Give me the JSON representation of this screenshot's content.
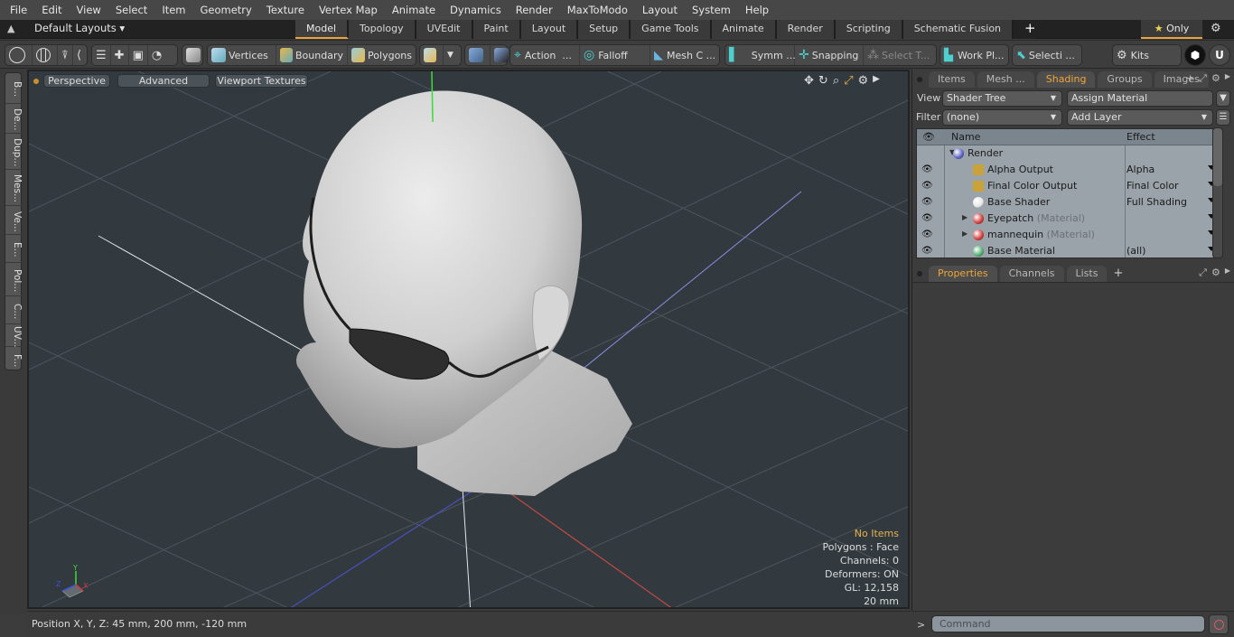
{
  "menubar": {
    "items": [
      "File",
      "Edit",
      "View",
      "Select",
      "Item",
      "Geometry",
      "Texture",
      "Vertex Map",
      "Animate",
      "Dynamics",
      "Render",
      "MaxToModo",
      "Layout",
      "System",
      "Help"
    ]
  },
  "layoutbar": {
    "layout_dropdown": "Default Layouts",
    "tabs": [
      "Model",
      "Topology",
      "UVEdit",
      "Paint",
      "Layout",
      "Setup",
      "Game Tools",
      "Animate",
      "Render",
      "Scripting",
      "Schematic Fusion"
    ],
    "active_tab": "Model",
    "add_tab": "+",
    "only_label": "Only"
  },
  "toolbar": {
    "vertices": "Vertices",
    "boundary": "Boundary",
    "polygons": "Polygons",
    "action": "Action",
    "action_more": "...",
    "falloff": "Falloff",
    "mesh_constraints": "Mesh C ...",
    "symmetry": "Symm ...",
    "snapping": "Snapping",
    "select_through": "Select T...",
    "work_plane": "Work Pl...",
    "selection_sets": "Selecti ...",
    "kits": "Kits"
  },
  "left_strip": {
    "tabs": [
      "B...",
      "De...",
      "Dup...",
      "Mes...",
      "Ve...",
      "E...",
      "Pol...",
      "C...",
      "UV...",
      "F..."
    ]
  },
  "viewport": {
    "view_mode": "Perspective",
    "shading_mode": "Advanced",
    "texture_mode": "Viewport Textures",
    "info": {
      "selection": "No Items",
      "polygons": "Polygons : Face",
      "channels": "Channels: 0",
      "deformers": "Deformers: ON",
      "gl": "GL: 12,158",
      "grid": "20 mm"
    },
    "axis_labels": {
      "x": "X",
      "y": "Y",
      "z": "Z"
    }
  },
  "statusbar": {
    "position": "Position X, Y, Z:   45 mm, 200 mm, -120 mm"
  },
  "right_panel": {
    "tabs": [
      "Items",
      "Mesh ...",
      "Shading",
      "Groups",
      "Images"
    ],
    "active_tab": "Shading",
    "view_label": "View",
    "view_value": "Shader Tree",
    "assign_material": "Assign Material",
    "filter_label": "Filter",
    "filter_value": "(none)",
    "add_layer": "Add Layer",
    "columns": {
      "name": "Name",
      "effect": "Effect"
    },
    "rows": [
      {
        "name": "Render",
        "sub": "",
        "effect": "",
        "color": "#5a5fc0",
        "level": 0
      },
      {
        "name": "Alpha Output",
        "sub": "",
        "effect": "Alpha",
        "color": "#c9a23a",
        "level": 1
      },
      {
        "name": "Final Color Output",
        "sub": "",
        "effect": "Final Color",
        "color": "#c9a23a",
        "level": 1
      },
      {
        "name": "Base Shader",
        "sub": "",
        "effect": "Full Shading",
        "color": "#e6e6e6",
        "level": 1
      },
      {
        "name": "Eyepatch",
        "sub": "(Material)",
        "effect": "",
        "color": "#d23a3a",
        "level": 1
      },
      {
        "name": "mannequin",
        "sub": "(Material)",
        "effect": "",
        "color": "#d23a3a",
        "level": 1
      },
      {
        "name": "Base Material",
        "sub": "",
        "effect": "(all)",
        "color": "#4fae6f",
        "level": 1
      }
    ],
    "bottom_tabs": [
      "Properties",
      "Channels",
      "Lists"
    ],
    "bottom_active": "Properties"
  },
  "command": {
    "prompt": ">",
    "placeholder": "Command"
  }
}
